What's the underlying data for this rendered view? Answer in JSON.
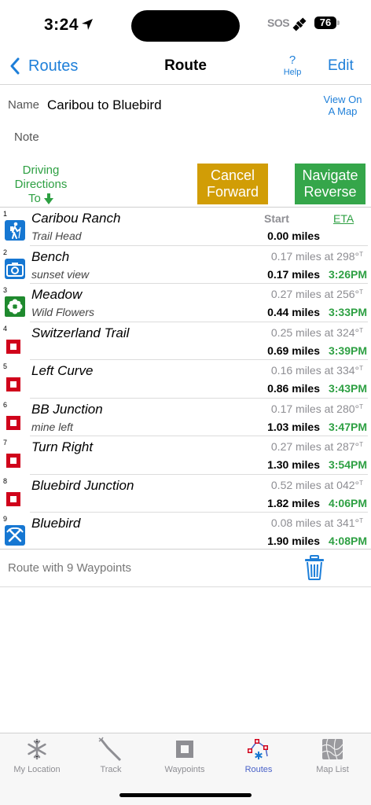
{
  "status_bar": {
    "time": "3:24",
    "sos": "SOS",
    "battery": "76"
  },
  "nav": {
    "back_label": "Routes",
    "title": "Route",
    "help_q": "?",
    "help_label": "Help",
    "edit_label": "Edit"
  },
  "route": {
    "name_label": "Name",
    "name": "Caribou to Bluebird",
    "view_map_line1": "View On",
    "view_map_line2": "A Map",
    "note_label": "Note"
  },
  "actions": {
    "driving_line1": "Driving",
    "driving_line2": "Directions",
    "driving_line3": "To",
    "cancel_line1": "Cancel",
    "cancel_line2": "Forward",
    "navigate_line1": "Navigate",
    "navigate_line2": "Reverse"
  },
  "list_header": {
    "start": "Start",
    "eta": "ETA"
  },
  "waypoints": [
    {
      "num": "1",
      "icon": "hiker-icon",
      "name": "Caribou Ranch",
      "desc": "Trail Head",
      "leg_dist": "",
      "leg_bearing": "",
      "leg_unit": "",
      "cum": "0.00 miles",
      "eta": ""
    },
    {
      "num": "2",
      "icon": "camera-icon",
      "name": "Bench",
      "desc": "sunset view",
      "leg_dist": "0.17 miles at 298°",
      "leg_bearing": "",
      "leg_unit": "T",
      "cum": "0.17 miles",
      "eta": "3:26PM"
    },
    {
      "num": "3",
      "icon": "flower-icon",
      "name": "Meadow",
      "desc": "Wild Flowers",
      "leg_dist": "0.27 miles at 256°",
      "leg_bearing": "",
      "leg_unit": "T",
      "cum": "0.44 miles",
      "eta": "3:33PM"
    },
    {
      "num": "4",
      "icon": "square-marker-icon",
      "name": "Switzerland Trail",
      "desc": "",
      "leg_dist": "0.25 miles at 324°",
      "leg_bearing": "",
      "leg_unit": "T",
      "cum": "0.69 miles",
      "eta": "3:39PM"
    },
    {
      "num": "5",
      "icon": "square-marker-icon",
      "name": "Left Curve",
      "desc": "",
      "leg_dist": "0.16 miles at 334°",
      "leg_bearing": "",
      "leg_unit": "T",
      "cum": "0.86 miles",
      "eta": "3:43PM"
    },
    {
      "num": "6",
      "icon": "square-marker-icon",
      "name": "BB Junction",
      "desc": "mine left",
      "leg_dist": "0.17 miles at 280°",
      "leg_bearing": "",
      "leg_unit": "T",
      "cum": "1.03 miles",
      "eta": "3:47PM"
    },
    {
      "num": "7",
      "icon": "square-marker-icon",
      "name": "Turn Right",
      "desc": "",
      "leg_dist": "0.27 miles at 287°",
      "leg_bearing": "",
      "leg_unit": "T",
      "cum": "1.30 miles",
      "eta": "3:54PM"
    },
    {
      "num": "8",
      "icon": "square-marker-icon",
      "name": "Bluebird Junction",
      "desc": "",
      "leg_dist": "0.52 miles at 042°",
      "leg_bearing": "",
      "leg_unit": "T",
      "cum": "1.82 miles",
      "eta": "4:06PM"
    },
    {
      "num": "9",
      "icon": "mine-icon",
      "name": "Bluebird",
      "desc": "",
      "leg_dist": "0.08 miles at 341°",
      "leg_bearing": "",
      "leg_unit": "T",
      "cum": "1.90 miles",
      "eta": "4:08PM"
    }
  ],
  "summary": "Route with 9 Waypoints",
  "tabs": [
    {
      "label": "My Location",
      "icon": "snowflake-icon",
      "active": false
    },
    {
      "label": "Track",
      "icon": "track-icon",
      "active": false
    },
    {
      "label": "Waypoints",
      "icon": "waypoint-square-icon",
      "active": false
    },
    {
      "label": "Routes",
      "icon": "routes-icon",
      "active": true
    },
    {
      "label": "Map List",
      "icon": "map-list-icon",
      "active": false
    }
  ],
  "colors": {
    "accent_blue": "#1e7fd9",
    "green": "#2ea043",
    "cancel_gold": "#d19d06",
    "navigate_green": "#35a64a",
    "marker_red": "#d0021b",
    "tab_active": "#4a62c8"
  }
}
